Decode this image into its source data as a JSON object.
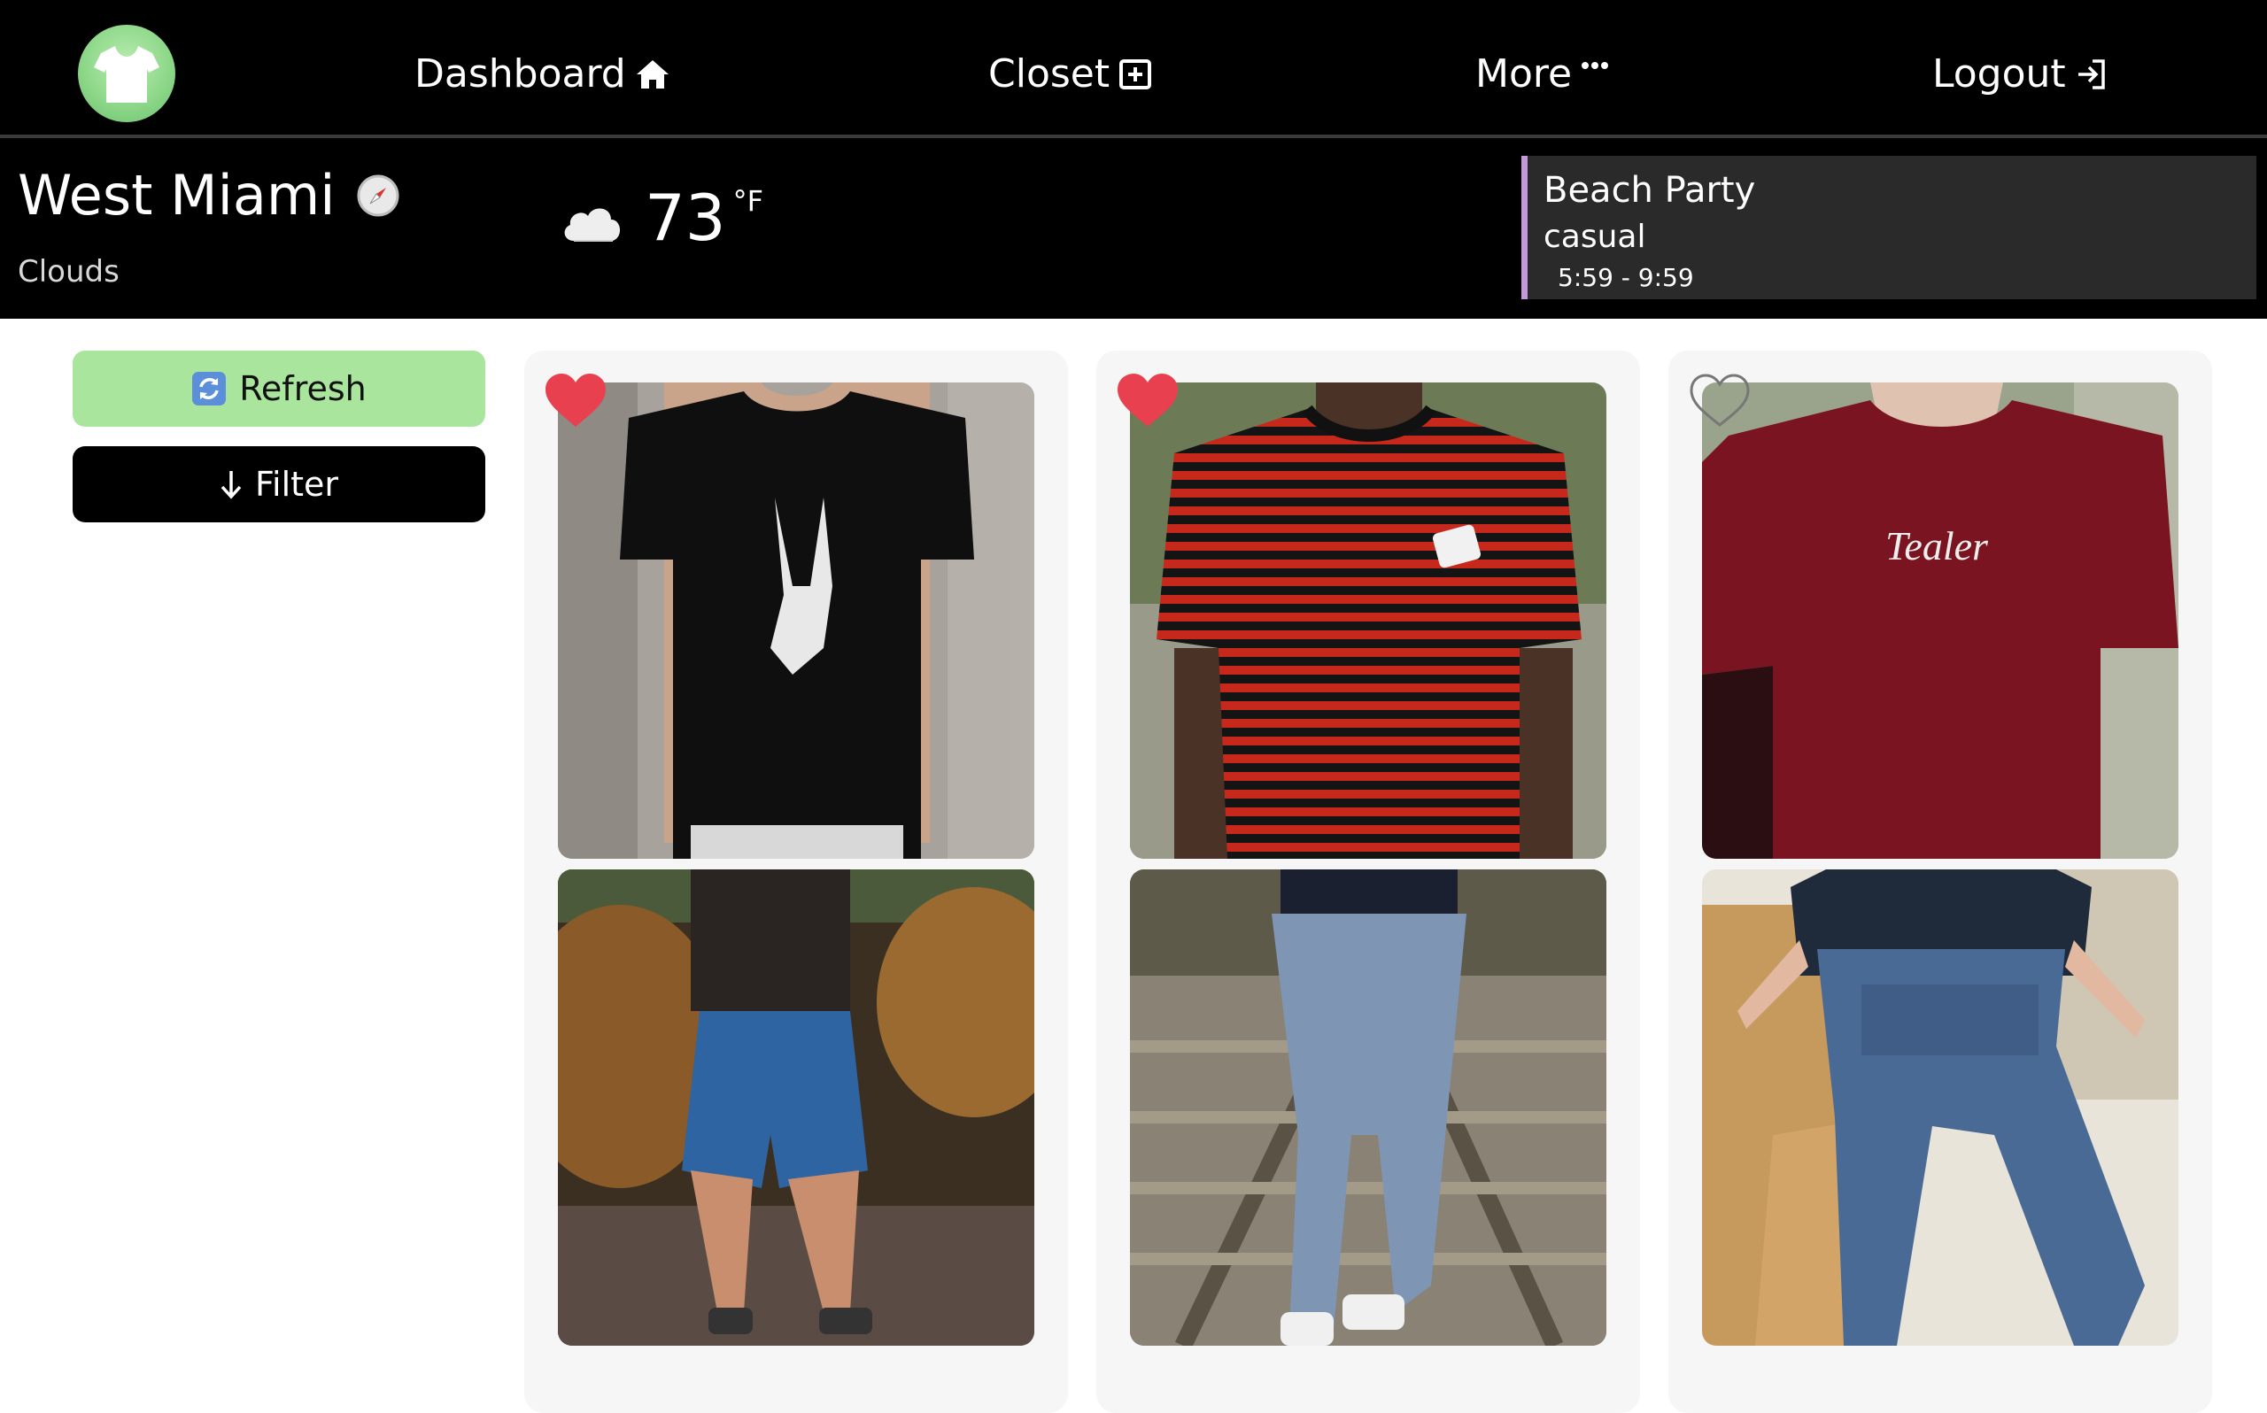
{
  "nav": {
    "items": [
      {
        "label": "Dashboard",
        "icon": "home-icon"
      },
      {
        "label": "Closet",
        "icon": "plus-square-icon"
      },
      {
        "label": "More",
        "icon": "ellipsis-icon"
      },
      {
        "label": "Logout",
        "icon": "sign-in-icon"
      }
    ],
    "logo": "tshirt-icon"
  },
  "weather": {
    "city": "West Miami",
    "conditions": "Clouds",
    "temperature": "73",
    "unit": "°F",
    "icon": "cloud-icon",
    "location_icon": "compass-icon"
  },
  "event": {
    "title": "Beach Party",
    "dress_code": "casual",
    "time": "5:59 - 9:59"
  },
  "sidebar": {
    "refresh_label": "Refresh",
    "filter_label": "Filter",
    "refresh_icon": "refresh-icon",
    "filter_icon": "arrow-down-icon"
  },
  "outfits": [
    {
      "favorite": true,
      "top": "black skeleton peace-sign t-shirt",
      "bottom": "blue shorts"
    },
    {
      "favorite": true,
      "top": "red and black striped t-shirt with dice patch",
      "bottom": "light ripped jeans"
    },
    {
      "favorite": false,
      "top": "maroon Tealer t-shirt",
      "bottom": "denim overalls"
    }
  ],
  "colors": {
    "nav_bg": "#000000",
    "refresh_bg": "#a9e59d",
    "filter_bg": "#000000",
    "event_accent": "#c39ad7",
    "heart_red": "#e8404e"
  },
  "print": {
    "shirt3_brand": "Tealer"
  }
}
